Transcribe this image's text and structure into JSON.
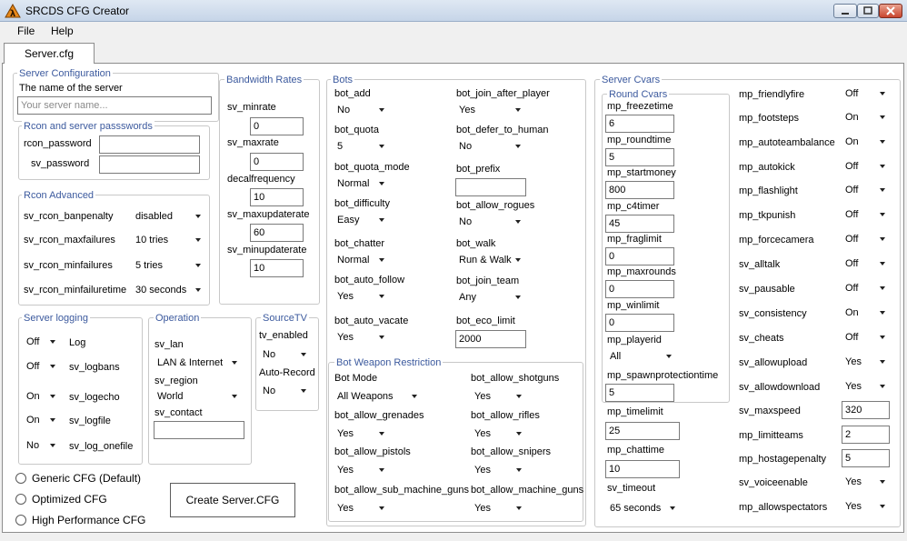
{
  "window": {
    "title": "SRCDS CFG Creator"
  },
  "menu": {
    "file": "File",
    "help": "Help"
  },
  "tab": {
    "label": "Server.cfg"
  },
  "server_config": {
    "title": "Server Configuration",
    "name_label": "The name of the server",
    "name_placeholder": "Your server name..."
  },
  "rcon_passwords": {
    "title": "Rcon and server passswords",
    "rcon_label": "rcon_password",
    "sv_label": "sv_password"
  },
  "rcon_advanced": {
    "title": "Rcon Advanced",
    "items": [
      {
        "label": "sv_rcon_banpenalty",
        "value": "disabled"
      },
      {
        "label": "sv_rcon_maxfailures",
        "value": "10 tries"
      },
      {
        "label": "sv_rcon_minfailures",
        "value": "5 tries"
      },
      {
        "label": "sv_rcon_minfailuretime",
        "value": "30 seconds"
      }
    ]
  },
  "bandwidth": {
    "title": "Bandwidth Rates",
    "items": [
      {
        "label": "sv_minrate",
        "value": "0"
      },
      {
        "label": "sv_maxrate",
        "value": "0"
      },
      {
        "label": "decalfrequency",
        "value": "10"
      },
      {
        "label": "sv_maxupdaterate",
        "value": "60"
      },
      {
        "label": "sv_minupdaterate",
        "value": "10"
      }
    ]
  },
  "logging": {
    "title": "Server logging",
    "items": [
      {
        "label": "Log",
        "value": "Off"
      },
      {
        "label": "sv_logbans",
        "value": "Off"
      },
      {
        "label": "sv_logecho",
        "value": "On"
      },
      {
        "label": "sv_logfile",
        "value": "On"
      },
      {
        "label": "sv_log_onefile",
        "value": "No"
      }
    ]
  },
  "operation": {
    "title": "Operation",
    "lan_label": "sv_lan",
    "lan_value": "LAN & Internet",
    "region_label": "sv_region",
    "region_value": "World",
    "contact_label": "sv_contact",
    "contact_value": ""
  },
  "sourcetv": {
    "title": "SourceTV",
    "enabled_label": "tv_enabled",
    "enabled_value": "No",
    "autorecord_label": "Auto-Record",
    "autorecord_value": "No"
  },
  "cfg_types": {
    "options": [
      "Generic CFG (Default)",
      "Optimized CFG",
      "High Performance CFG"
    ]
  },
  "create_button": "Create Server.CFG",
  "bots": {
    "title": "Bots",
    "left": [
      {
        "label": "bot_add",
        "value": "No",
        "type": "dropdown"
      },
      {
        "label": "bot_quota",
        "value": "5",
        "type": "dropdown"
      },
      {
        "label": "bot_quota_mode",
        "value": "Normal",
        "type": "dropdown"
      },
      {
        "label": "bot_difficulty",
        "value": "Easy",
        "type": "dropdown"
      },
      {
        "label": "bot_chatter",
        "value": "Normal",
        "type": "dropdown"
      },
      {
        "label": "bot_auto_follow",
        "value": "Yes",
        "type": "dropdown"
      },
      {
        "label": "bot_auto_vacate",
        "value": "Yes",
        "type": "dropdown"
      }
    ],
    "right": [
      {
        "label": "bot_join_after_player",
        "value": "Yes",
        "type": "dropdown"
      },
      {
        "label": "bot_defer_to_human",
        "value": "No",
        "type": "dropdown"
      },
      {
        "label": "bot_prefix",
        "value": "",
        "type": "text"
      },
      {
        "label": "bot_allow_rogues",
        "value": "No",
        "type": "dropdown"
      },
      {
        "label": "bot_walk",
        "value": "Run & Walk",
        "type": "dropdown"
      },
      {
        "label": "bot_join_team",
        "value": "Any",
        "type": "dropdown"
      },
      {
        "label": "bot_eco_limit",
        "value": "2000",
        "type": "text"
      }
    ]
  },
  "weapon_restriction": {
    "title": "Bot Weapon Restriction",
    "left": [
      {
        "label": "Bot Mode",
        "value": "All Weapons"
      },
      {
        "label": "bot_allow_grenades",
        "value": "Yes"
      },
      {
        "label": "bot_allow_pistols",
        "value": "Yes"
      },
      {
        "label": "bot_allow_sub_machine_guns",
        "value": "Yes"
      }
    ],
    "right": [
      {
        "label": "bot_allow_shotguns",
        "value": "Yes"
      },
      {
        "label": "bot_allow_rifles",
        "value": "Yes"
      },
      {
        "label": "bot_allow_snipers",
        "value": "Yes"
      },
      {
        "label": "bot_allow_machine_guns",
        "value": "Yes"
      }
    ]
  },
  "server_cvars": {
    "title": "Server Cvars",
    "round_title": "Round Cvars",
    "round": [
      {
        "label": "mp_freezetime",
        "value": "6",
        "type": "text"
      },
      {
        "label": "mp_roundtime",
        "value": "5",
        "type": "text"
      },
      {
        "label": "mp_startmoney",
        "value": "800",
        "type": "text"
      },
      {
        "label": "mp_c4timer",
        "value": "45",
        "type": "text"
      },
      {
        "label": "mp_fraglimit",
        "value": "0",
        "type": "text"
      },
      {
        "label": "mp_maxrounds",
        "value": "0",
        "type": "text"
      },
      {
        "label": "mp_winlimit",
        "value": "0",
        "type": "text"
      },
      {
        "label": "mp_playerid",
        "value": "All",
        "type": "dropdown"
      },
      {
        "label": "mp_spawnprotectiontime",
        "value": "5",
        "type": "text"
      }
    ],
    "misc": [
      {
        "label": "mp_timelimit",
        "value": "25",
        "type": "text"
      },
      {
        "label": "mp_chattime",
        "value": "10",
        "type": "text"
      },
      {
        "label": "sv_timeout",
        "value": "65 seconds",
        "type": "dropdown"
      }
    ],
    "right": [
      {
        "label": "mp_friendlyfire",
        "value": "Off",
        "type": "dropdown"
      },
      {
        "label": "mp_footsteps",
        "value": "On",
        "type": "dropdown"
      },
      {
        "label": "mp_autoteambalance",
        "value": "On",
        "type": "dropdown"
      },
      {
        "label": "mp_autokick",
        "value": "Off",
        "type": "dropdown"
      },
      {
        "label": "mp_flashlight",
        "value": "Off",
        "type": "dropdown"
      },
      {
        "label": "mp_tkpunish",
        "value": "Off",
        "type": "dropdown"
      },
      {
        "label": "mp_forcecamera",
        "value": "Off",
        "type": "dropdown"
      },
      {
        "label": "sv_alltalk",
        "value": "Off",
        "type": "dropdown"
      },
      {
        "label": "sv_pausable",
        "value": "Off",
        "type": "dropdown"
      },
      {
        "label": "sv_consistency",
        "value": "On",
        "type": "dropdown"
      },
      {
        "label": "sv_cheats",
        "value": "Off",
        "type": "dropdown"
      },
      {
        "label": "sv_allowupload",
        "value": "Yes",
        "type": "dropdown"
      },
      {
        "label": "sv_allowdownload",
        "value": "Yes",
        "type": "dropdown"
      },
      {
        "label": "sv_maxspeed",
        "value": "320",
        "type": "text"
      },
      {
        "label": "mp_limitteams",
        "value": "2",
        "type": "text"
      },
      {
        "label": "mp_hostagepenalty",
        "value": "5",
        "type": "text"
      },
      {
        "label": "sv_voiceenable",
        "value": "Yes",
        "type": "dropdown"
      },
      {
        "label": "mp_allowspectators",
        "value": "Yes",
        "type": "dropdown"
      }
    ]
  }
}
